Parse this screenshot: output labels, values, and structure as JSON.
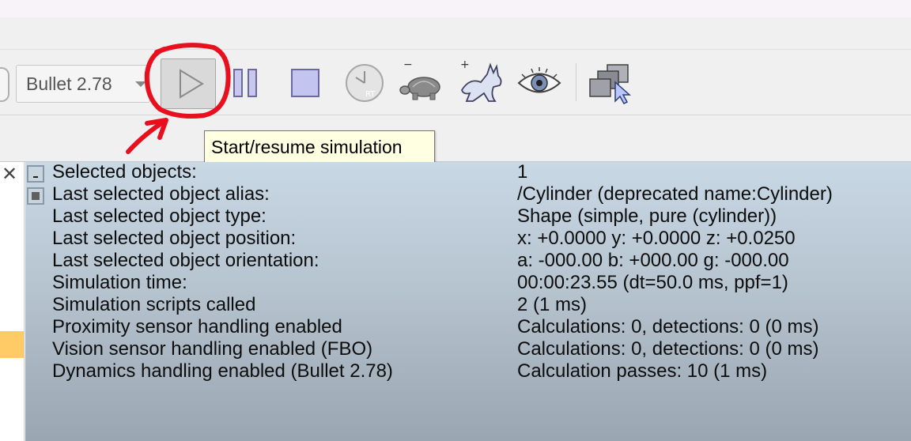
{
  "toolbar": {
    "engine_select": {
      "value": "Bullet 2.78"
    },
    "buttons": [
      {
        "icon": "play-icon"
      },
      {
        "icon": "pause-icon"
      },
      {
        "icon": "stop-icon"
      },
      {
        "icon": "realtime-clock-icon",
        "badge": "RT"
      },
      {
        "icon": "turtle-slower-icon",
        "modifier": "−"
      },
      {
        "icon": "rabbit-faster-icon",
        "modifier": "+"
      },
      {
        "icon": "eye-icon"
      },
      {
        "icon": "windows-cursor-icon"
      }
    ]
  },
  "tooltip": {
    "text": "Start/resume simulation"
  },
  "annotation_color": "#e8101e",
  "info_panel": {
    "rows": [
      {
        "label": "Selected objects:",
        "value": "1"
      },
      {
        "label": "Last selected object alias:",
        "value": "/Cylinder    (deprecated name:Cylinder)"
      },
      {
        "label": "Last selected object type:",
        "value": "Shape (simple, pure (cylinder))"
      },
      {
        "label": "Last selected object position:",
        "value": "x: +0.0000    y: +0.0000    z: +0.0250"
      },
      {
        "label": "Last selected object orientation:",
        "value": "a: -000.00    b: +000.00    g: -000.00"
      },
      {
        "label": "Simulation time:",
        "value": "00:00:23.55 (dt=50.0 ms, ppf=1)"
      },
      {
        "label": "Simulation scripts called",
        "value": "2 (1 ms)"
      },
      {
        "label": "Proximity sensor handling enabled",
        "value": "Calculations: 0, detections: 0 (0 ms)"
      },
      {
        "label": "Vision sensor handling enabled (FBO)",
        "value": "Calculations: 0, detections: 0 (0 ms)"
      },
      {
        "label": "Dynamics handling enabled (Bullet 2.78)",
        "value": "Calculation passes: 10 (1 ms)"
      }
    ]
  }
}
